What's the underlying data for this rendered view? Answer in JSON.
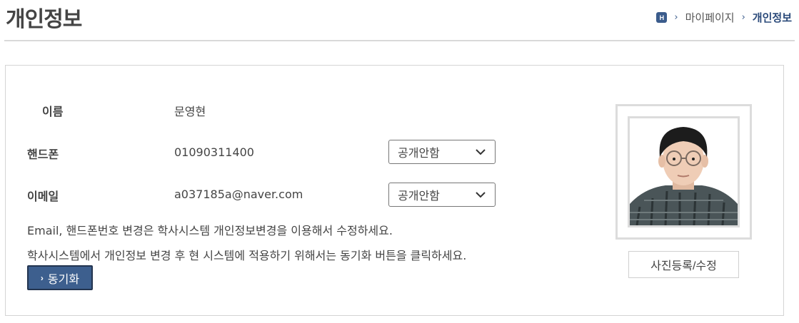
{
  "page": {
    "title": "개인정보"
  },
  "breadcrumb": {
    "home_icon": "H",
    "items": [
      "마이페이지",
      "개인정보"
    ]
  },
  "profile": {
    "name_label": "이름",
    "name_value": "문영현",
    "phone_label": "핸드폰",
    "phone_value": "01090311400",
    "phone_visibility": "공개안함",
    "email_label": "이메일",
    "email_value": "a037185a@naver.com",
    "email_visibility": "공개안함"
  },
  "notices": [
    "Email, 핸드폰번호 변경은 학사시스템 개인정보변경을 이용해서 수정하세요.",
    "학사시스템에서 개인정보 변경 후 현 시스템에 적용하기 위해서는 동기화 버튼을 클릭하세요."
  ],
  "buttons": {
    "sync_arrow": "›",
    "sync_label": "동기화",
    "photo_label": "사진등록/수정"
  },
  "colors": {
    "accent": "#3d5f8e",
    "border": "#d4d4d4"
  }
}
